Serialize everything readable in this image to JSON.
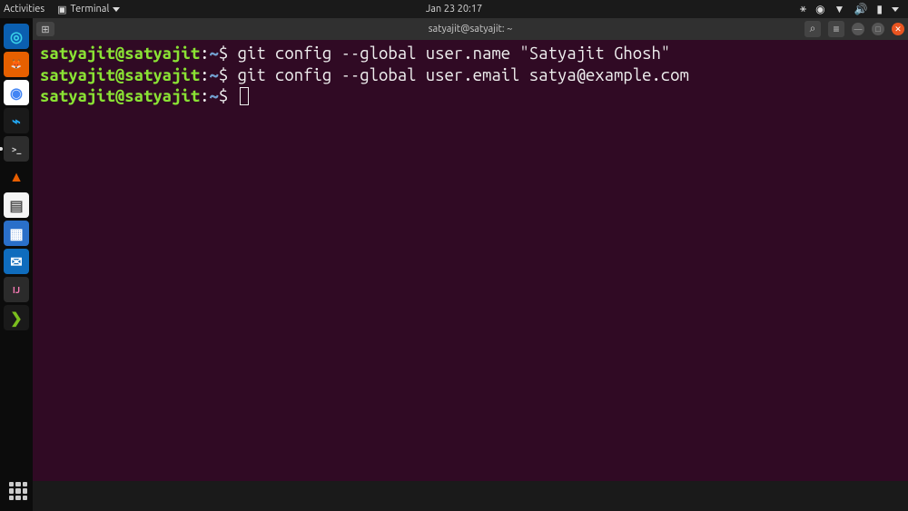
{
  "top_panel": {
    "activities": "Activities",
    "app_menu": "Terminal",
    "datetime": "Jan 23  20:17"
  },
  "dock": {
    "items": [
      {
        "name": "edge-icon",
        "bg": "#0b5fb0",
        "glyph": "◎",
        "fg": "#3ad0e8"
      },
      {
        "name": "firefox-icon",
        "bg": "#e66000",
        "glyph": "🦊",
        "fg": "#fff"
      },
      {
        "name": "chrome-icon",
        "bg": "#fff",
        "glyph": "◉",
        "fg": "#4285f4"
      },
      {
        "name": "vscode-icon",
        "bg": "#1a1a1a",
        "glyph": "⌁",
        "fg": "#22a6f1"
      },
      {
        "name": "terminal-icon",
        "bg": "#2d2d2d",
        "glyph": ">_",
        "fg": "#ccc",
        "active": true
      },
      {
        "name": "vlc-icon",
        "bg": "transparent",
        "glyph": "▲",
        "fg": "#e85e00"
      },
      {
        "name": "gedit-icon",
        "bg": "#f5f5f5",
        "glyph": "▤",
        "fg": "#555"
      },
      {
        "name": "libreoffice-icon",
        "bg": "#2a6fc9",
        "glyph": "▦",
        "fg": "#fff"
      },
      {
        "name": "outlook-icon",
        "bg": "#0f6cbd",
        "glyph": "✉",
        "fg": "#fff"
      },
      {
        "name": "intellij-icon",
        "bg": "#2b2b2b",
        "glyph": "IJ",
        "fg": "#f97ab6"
      },
      {
        "name": "app-icon",
        "bg": "#1a1a1a",
        "glyph": "❯",
        "fg": "#7bbf1e"
      }
    ]
  },
  "window": {
    "title": "satyajit@satyajit: ~"
  },
  "terminal": {
    "lines": [
      {
        "user": "satyajit@satyajit",
        "sep1": ":",
        "path": "~",
        "sep2": "$ ",
        "command": "git config --global user.name \"Satyajit Ghosh\""
      },
      {
        "user": "satyajit@satyajit",
        "sep1": ":",
        "path": "~",
        "sep2": "$ ",
        "command": "git config --global user.email satya@example.com"
      },
      {
        "user": "satyajit@satyajit",
        "sep1": ":",
        "path": "~",
        "sep2": "$ ",
        "command": "",
        "cursor": true
      }
    ]
  }
}
